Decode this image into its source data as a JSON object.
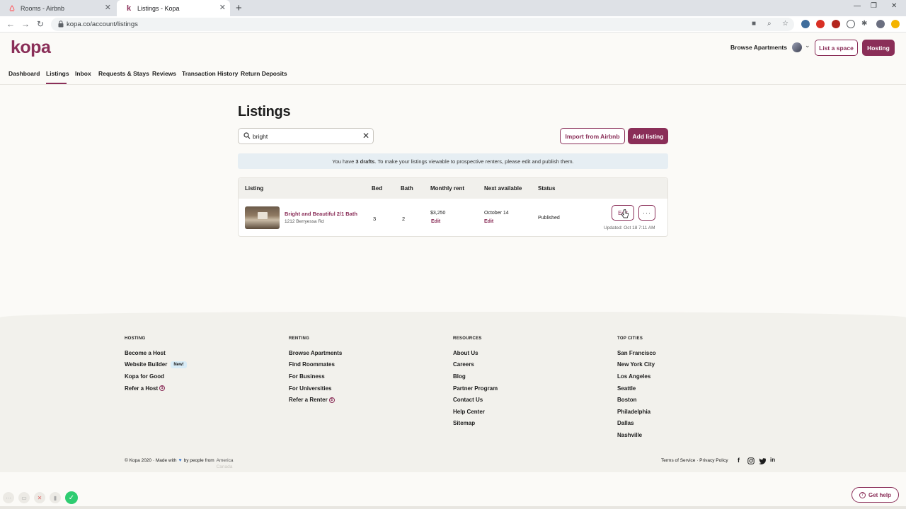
{
  "browser": {
    "tabs": [
      {
        "title": "Rooms - Airbnb",
        "icon": "airbnb-icon"
      },
      {
        "title": "Listings - Kopa",
        "icon": "kopa-k-icon",
        "active": true
      }
    ],
    "url": "kopa.co/account/listings"
  },
  "header": {
    "logo": "kopa",
    "browse_label": "Browse Apartments",
    "list_space_label": "List a space",
    "hosting_label": "Hosting"
  },
  "subnav": [
    "Dashboard",
    "Listings",
    "Inbox",
    "Requests & Stays",
    "Reviews",
    "Transaction History",
    "Return Deposits"
  ],
  "page": {
    "title": "Listings",
    "search_value": "bright",
    "import_label": "Import from Airbnb",
    "add_label": "Add listing",
    "notice_pre": "You have",
    "notice_bold": "3 drafts",
    "notice_post": ". To make your listings viewable to prospective renters, please edit and publish them."
  },
  "table": {
    "headers": [
      "Listing",
      "Bed",
      "Bath",
      "Monthly rent",
      "Next available",
      "Status"
    ],
    "rows": [
      {
        "title": "Bright and Beautiful 2/1 Bath",
        "address": "1212 Berryessa Rd",
        "bed": "3",
        "bath": "2",
        "rent": "$3,250",
        "rent_edit": "Edit",
        "next_available": "October 14",
        "next_edit": "Edit",
        "status": "Published",
        "edit_label": "Edit",
        "more_label": "···",
        "updated": "Updated: Oct 18 7:11 AM"
      }
    ]
  },
  "footer": {
    "columns": [
      {
        "heading": "HOSTING",
        "links": [
          "Become a Host",
          "Website Builder",
          "Kopa for Good",
          "Refer a Host"
        ]
      },
      {
        "heading": "RENTING",
        "links": [
          "Browse Apartments",
          "Find Roommates",
          "For Business",
          "For Universities",
          "Refer a Renter"
        ]
      },
      {
        "heading": "RESOURCES",
        "links": [
          "About Us",
          "Careers",
          "Blog",
          "Partner Program",
          "Contact Us",
          "Help Center",
          "Sitemap"
        ]
      },
      {
        "heading": "TOP CITIES",
        "links": [
          "San Francisco",
          "New York City",
          "Los Angeles",
          "Seattle",
          "Boston",
          "Philadelphia",
          "Dallas",
          "Nashville"
        ]
      }
    ],
    "new_badge": "New!",
    "copyright_pre": "© Kopa 2020 · Made with",
    "copyright_post": "by people from",
    "country_1": "America",
    "country_2": "Canada",
    "legal": "Terms of Service · Privacy Policy",
    "get_help": "Get help"
  },
  "colors": {
    "brand": "#8a2e58",
    "notice_bg": "#e6eef3"
  }
}
